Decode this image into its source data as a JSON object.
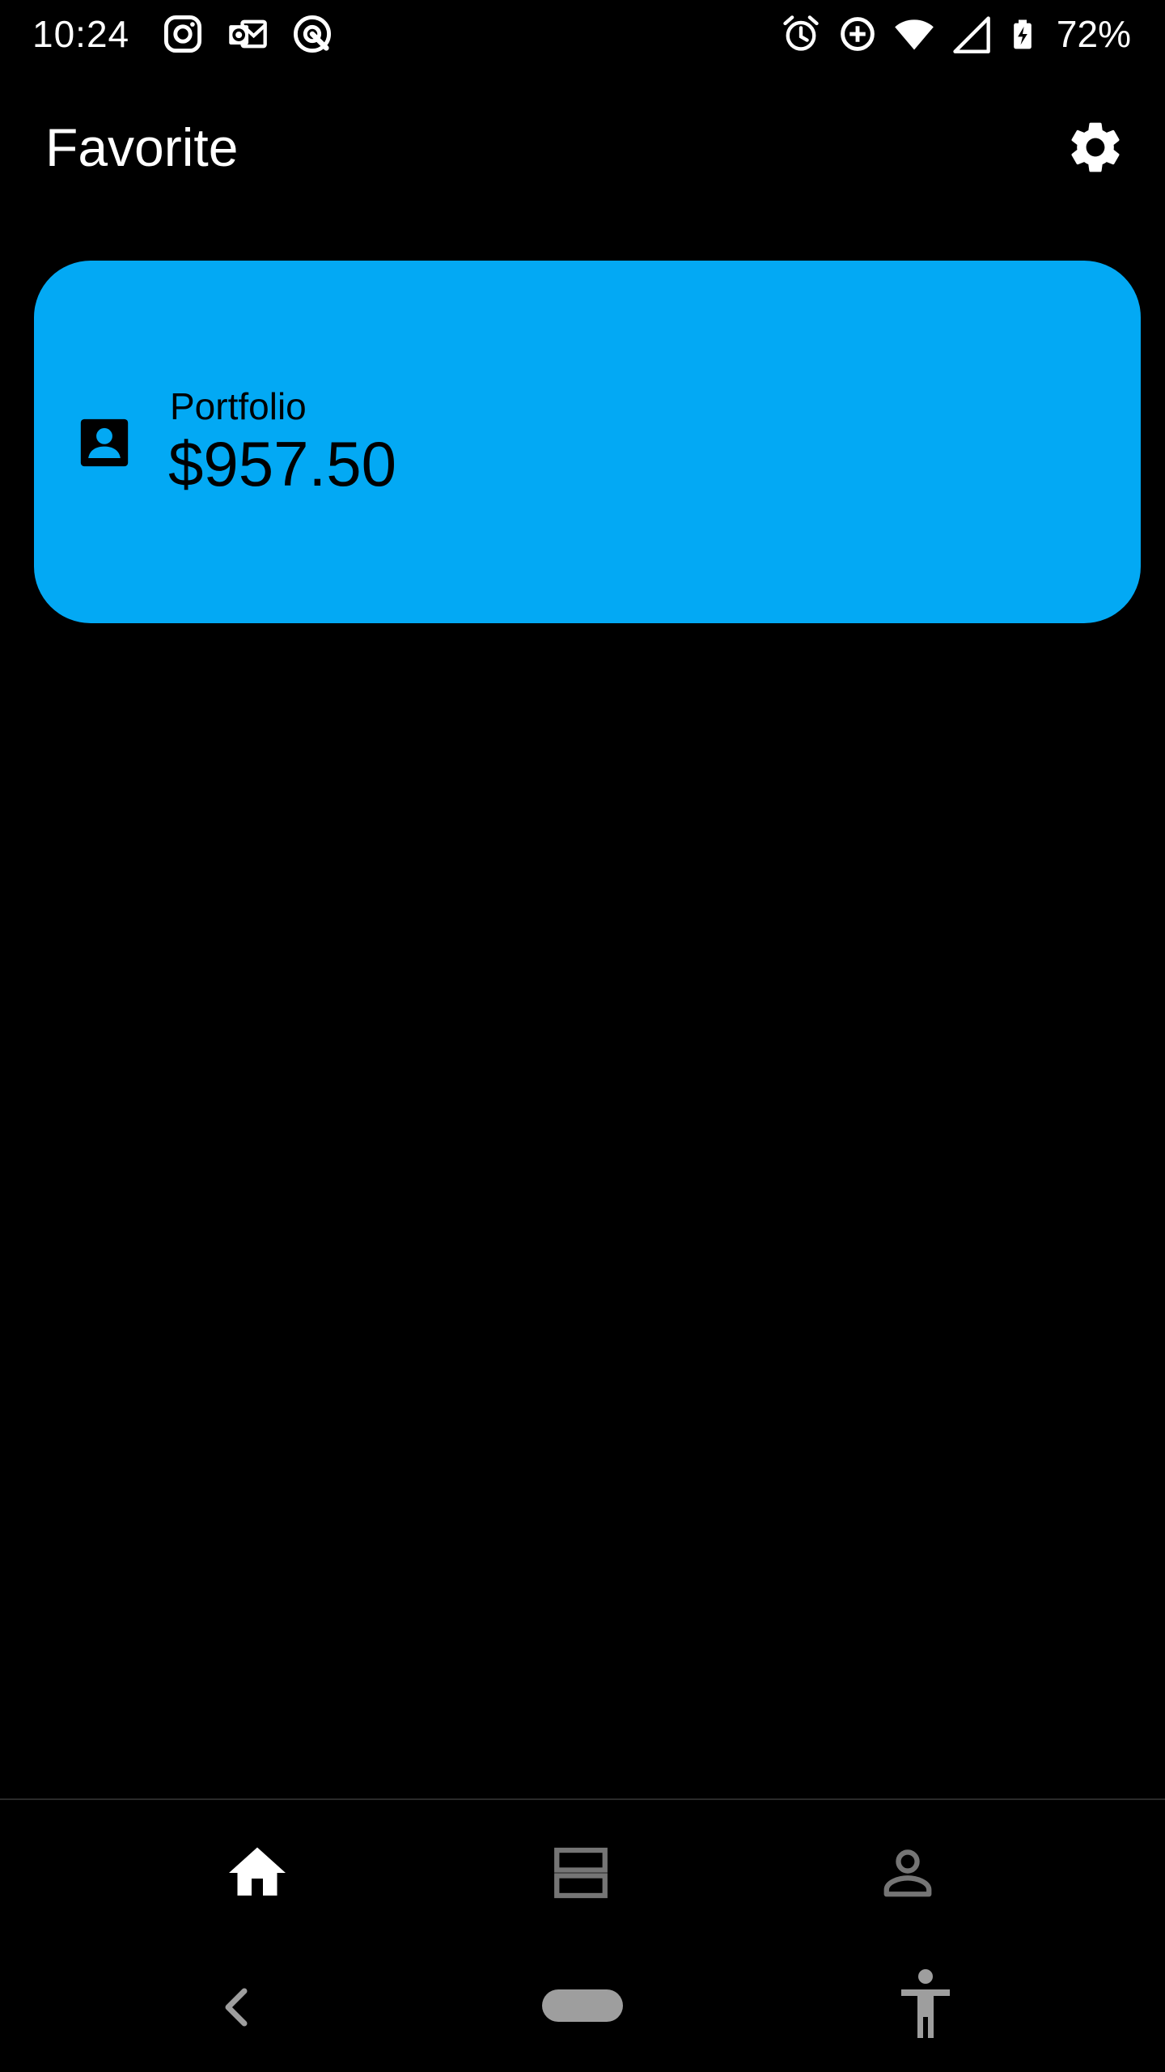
{
  "status_bar": {
    "time": "10:24",
    "battery_percent": "72%",
    "left_icons": [
      "instagram-icon",
      "outlook-icon",
      "radar-app-icon"
    ],
    "right_icons": [
      "alarm-icon",
      "data-saver-icon",
      "wifi-icon",
      "signal-icon",
      "battery-charging-icon"
    ]
  },
  "header": {
    "title": "Favorite",
    "settings_icon": "gear-icon"
  },
  "portfolio_card": {
    "icon": "contact-card-icon",
    "label": "Portfolio",
    "value": "$957.50",
    "background_color": "#03a9f4"
  },
  "bottom_nav": {
    "items": [
      {
        "name": "home",
        "icon": "home-icon",
        "active": true
      },
      {
        "name": "list",
        "icon": "list-view-icon",
        "active": false
      },
      {
        "name": "profile",
        "icon": "person-icon",
        "active": false
      }
    ],
    "active_color": "#ffffff",
    "inactive_color": "#757575"
  },
  "system_nav": {
    "back_icon": "back-chevron-icon",
    "home_pill": "home-pill",
    "accessibility_icon": "accessibility-icon"
  }
}
